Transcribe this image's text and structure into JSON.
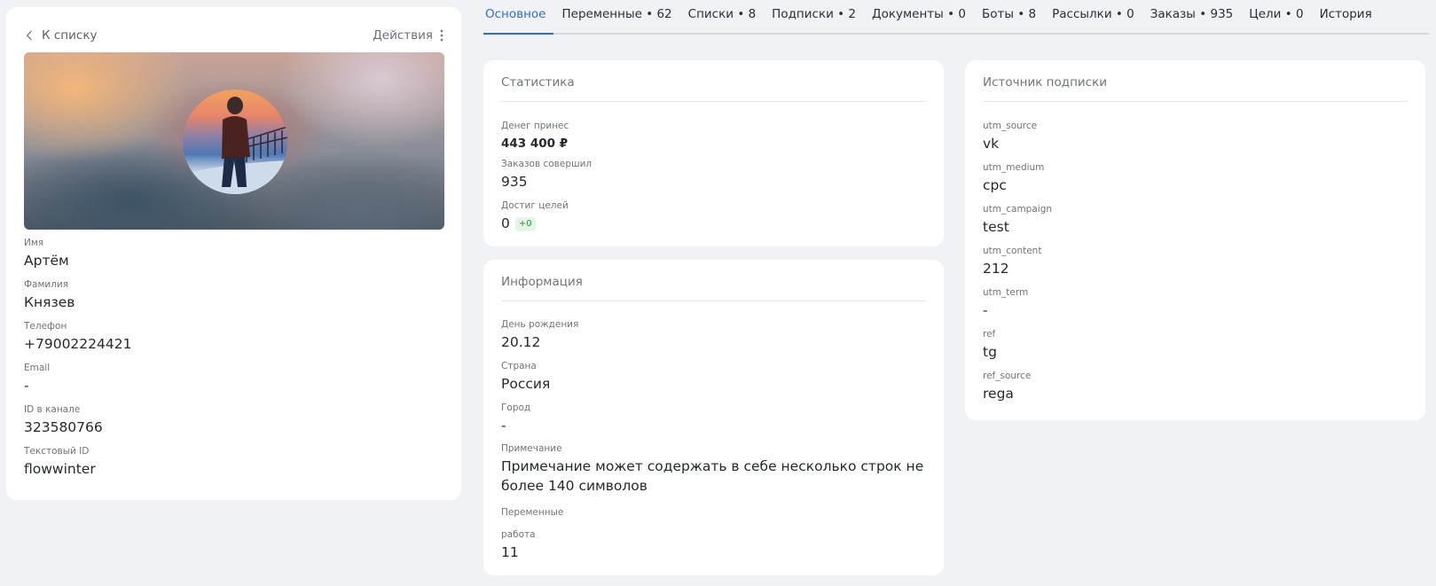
{
  "profile": {
    "back_label": "К списку",
    "actions_label": "Действия",
    "fields": {
      "first_name": {
        "label": "Имя",
        "value": "Артём"
      },
      "last_name": {
        "label": "Фамилия",
        "value": "Князев"
      },
      "phone": {
        "label": "Телефон",
        "value": "+79002224421"
      },
      "email": {
        "label": "Email",
        "value": "-"
      },
      "channel_id": {
        "label": "ID в канале",
        "value": "323580766"
      },
      "text_id": {
        "label": "Текстовый ID",
        "value": "flowwinter"
      }
    }
  },
  "tabs": [
    {
      "label": "Основное",
      "active": true
    },
    {
      "label": "Переменные • 62"
    },
    {
      "label": "Списки • 8"
    },
    {
      "label": "Подписки • 2"
    },
    {
      "label": "Документы • 0"
    },
    {
      "label": "Боты • 8"
    },
    {
      "label": "Рассылки • 0"
    },
    {
      "label": "Заказы • 935"
    },
    {
      "label": "Цели • 0"
    },
    {
      "label": "История"
    }
  ],
  "stats": {
    "title": "Статистика",
    "money": {
      "label": "Денег принес",
      "value": "443 400 ₽"
    },
    "orders": {
      "label": "Заказов совершил",
      "value": "935"
    },
    "goals": {
      "label": "Достиг целей",
      "value": "0",
      "badge": "+0"
    }
  },
  "info": {
    "title": "Информация",
    "birthday": {
      "label": "День рождения",
      "value": "20.12"
    },
    "country": {
      "label": "Страна",
      "value": "Россия"
    },
    "city": {
      "label": "Город",
      "value": "-"
    },
    "note": {
      "label": "Примечание",
      "value": "Примечание может содержать в себе несколько строк не более 140 символов"
    },
    "variables": {
      "label": "Переменные"
    },
    "work": {
      "label": "работа",
      "value": "11"
    }
  },
  "source": {
    "title": "Источник подписки",
    "utm_source": {
      "label": "utm_source",
      "value": "vk"
    },
    "utm_medium": {
      "label": "utm_medium",
      "value": "cpc"
    },
    "utm_campaign": {
      "label": "utm_campaign",
      "value": "test"
    },
    "utm_content": {
      "label": "utm_content",
      "value": "212"
    },
    "utm_term": {
      "label": "utm_term",
      "value": "-"
    },
    "ref": {
      "label": "ref",
      "value": "tg"
    },
    "ref_source": {
      "label": "ref_source",
      "value": "rega"
    }
  },
  "colors": {
    "accent": "#2f6fd0",
    "background": "#f1f2f5",
    "badge_green": "#2e8a4a"
  }
}
